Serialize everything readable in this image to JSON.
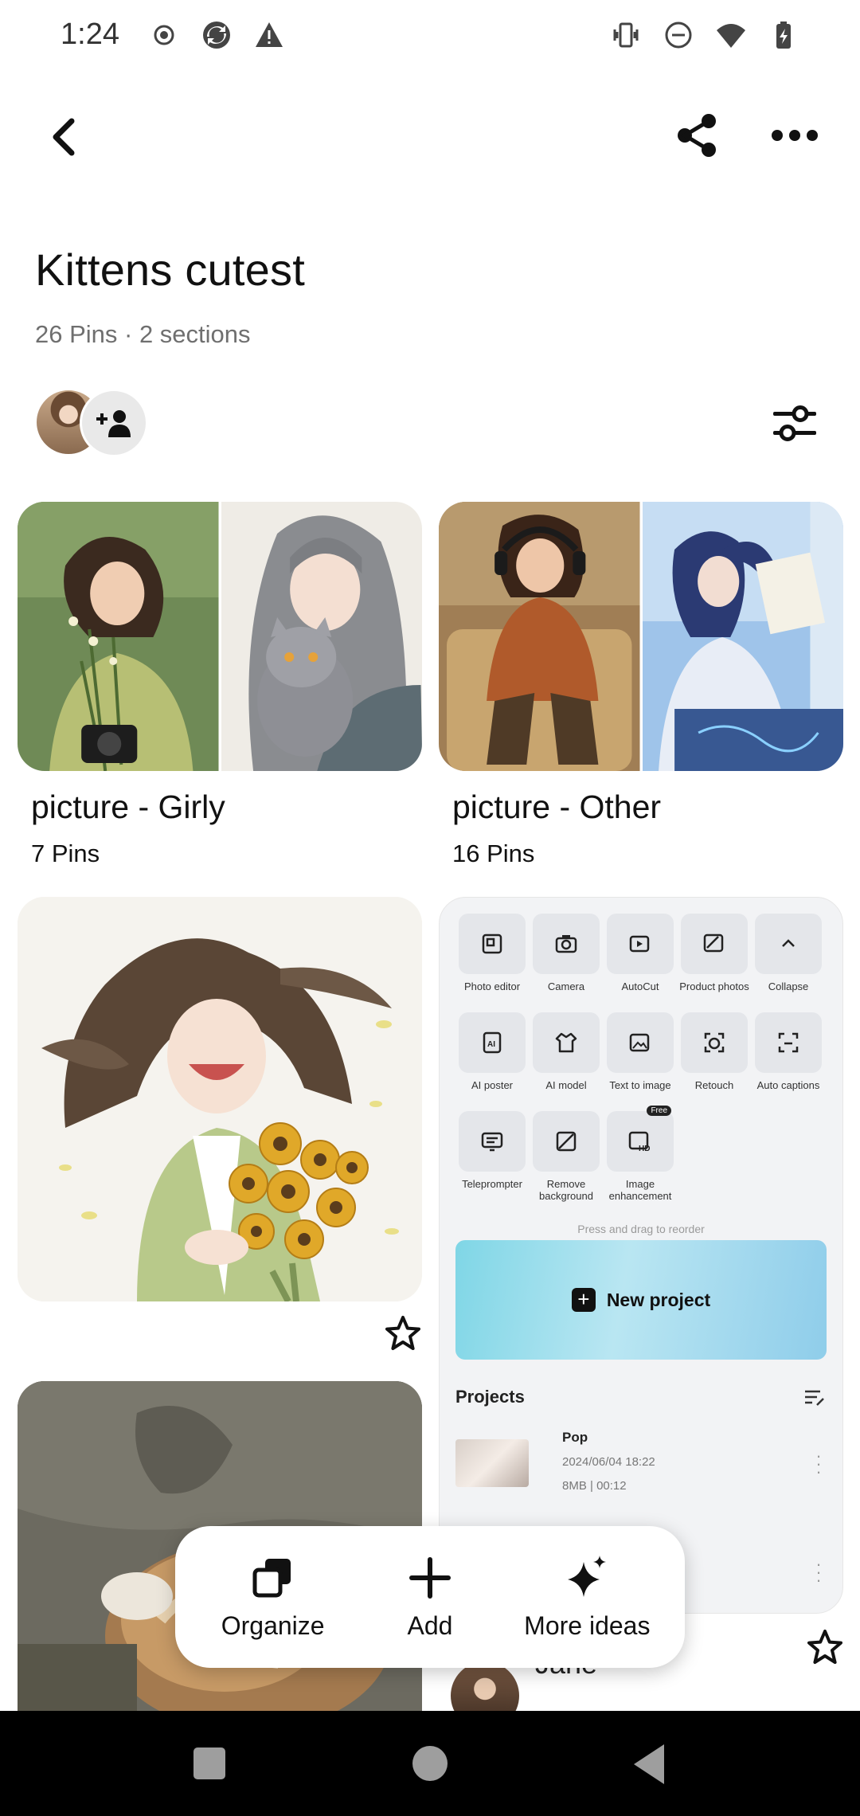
{
  "status_bar": {
    "time": "1:24",
    "left_icons": [
      "record-icon",
      "sync-icon",
      "alert-icon"
    ],
    "right_icons": [
      "vibrate-icon",
      "dnd-icon",
      "wifi-icon",
      "battery-icon"
    ]
  },
  "board": {
    "title": "Kittens cutest",
    "meta": "26 Pins · 2 sections"
  },
  "sections": [
    {
      "name": "picture - Girly",
      "count": "7 Pins"
    },
    {
      "name": "picture - Other",
      "count": "16 Pins"
    }
  ],
  "app_screenshot": {
    "tools": [
      {
        "label": "Photo editor",
        "icon": "photo-editor-icon"
      },
      {
        "label": "Camera",
        "icon": "camera-icon"
      },
      {
        "label": "AutoCut",
        "icon": "autocut-icon"
      },
      {
        "label": "Product photos",
        "icon": "product-photos-icon"
      },
      {
        "label": "Collapse",
        "icon": "chevron-up-icon"
      },
      {
        "label": "AI poster",
        "icon": "ai-poster-icon"
      },
      {
        "label": "AI model",
        "icon": "ai-model-icon"
      },
      {
        "label": "Text to image",
        "icon": "text-to-image-icon"
      },
      {
        "label": "Retouch",
        "icon": "retouch-icon"
      },
      {
        "label": "Auto captions",
        "icon": "auto-captions-icon"
      },
      {
        "label": "Teleprompter",
        "icon": "teleprompter-icon"
      },
      {
        "label": "Remove background",
        "icon": "remove-background-icon"
      },
      {
        "label": "Image enhancement",
        "icon": "image-enhancement-icon"
      }
    ],
    "free_badge": "Free",
    "reorder_hint": "Press and drag to reorder",
    "new_project": "New project",
    "projects_title": "Projects",
    "project": {
      "name": "Pop",
      "date": "2024/06/04 18:22",
      "size": "8MB",
      "duration": "00:12"
    }
  },
  "partial_pin_user": "Jane",
  "action_bar": {
    "organize": "Organize",
    "add": "Add",
    "more_ideas": "More ideas"
  }
}
